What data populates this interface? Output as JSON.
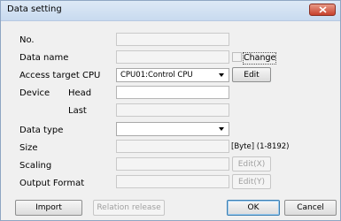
{
  "window": {
    "title": "Data setting",
    "close_icon": "close-icon"
  },
  "fields": {
    "no_label": "No.",
    "data_name_label": "Data name",
    "change_label": "Change",
    "access_target_cpu_label": "Access target CPU",
    "access_target_cpu_value": "CPU01:Control CPU",
    "edit_label": "Edit",
    "device_label": "Device",
    "head_label": "Head",
    "last_label": "Last",
    "data_type_label": "Data type",
    "size_label": "Size",
    "size_unit": "[Byte] (1-8192)",
    "scaling_label": "Scaling",
    "scaling_edit_label": "Edit(X)",
    "output_format_label": "Output Format",
    "output_edit_label": "Edit(Y)"
  },
  "footer": {
    "import_label": "Import",
    "relation_release_label": "Relation release",
    "ok_label": "OK",
    "cancel_label": "Cancel"
  }
}
